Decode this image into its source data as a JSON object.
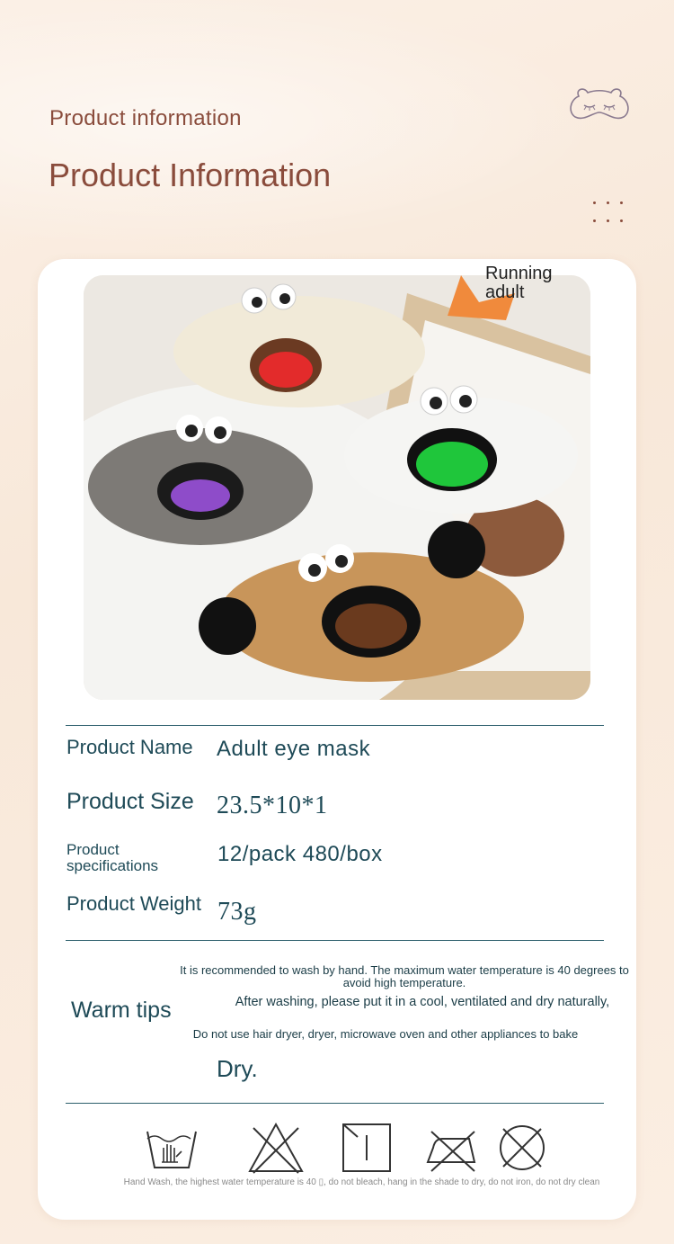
{
  "header": {
    "pre_title": "Product information",
    "title": "Product Information"
  },
  "photo": {
    "caption": "Running adult",
    "alt": "Four plush eye masks with googly eyes and open mouths"
  },
  "specs": [
    {
      "label": "Product Name",
      "value": "Adult eye mask"
    },
    {
      "label": "Product Size",
      "value": "23.5*10*1"
    },
    {
      "label": "Product specifications",
      "value": "12/pack 480/box"
    },
    {
      "label": "Product Weight",
      "value": "73g"
    }
  ],
  "warm_tips": {
    "label": "Warm tips",
    "line1": "It is recommended to wash by hand. The maximum water temperature is 40 degrees to avoid high temperature.",
    "line2": "After washing, please put it in a cool, ventilated and dry naturally,",
    "line3": "Do not use hair dryer, dryer, microwave oven and other appliances to bake",
    "line4": "Dry."
  },
  "care": {
    "icons": [
      "hand-wash-icon",
      "do-not-bleach-icon",
      "line-dry-shade-icon",
      "do-not-iron-icon",
      "do-not-dry-clean-icon"
    ],
    "note": "Hand Wash, the highest water temperature is 40 ▯, do not bleach, hang in the shade to dry, do not iron, do not dry clean"
  },
  "colors": {
    "title_brown": "#8a4c3c",
    "teal_text": "#1e4a57",
    "card_bg": "#ffffff"
  }
}
